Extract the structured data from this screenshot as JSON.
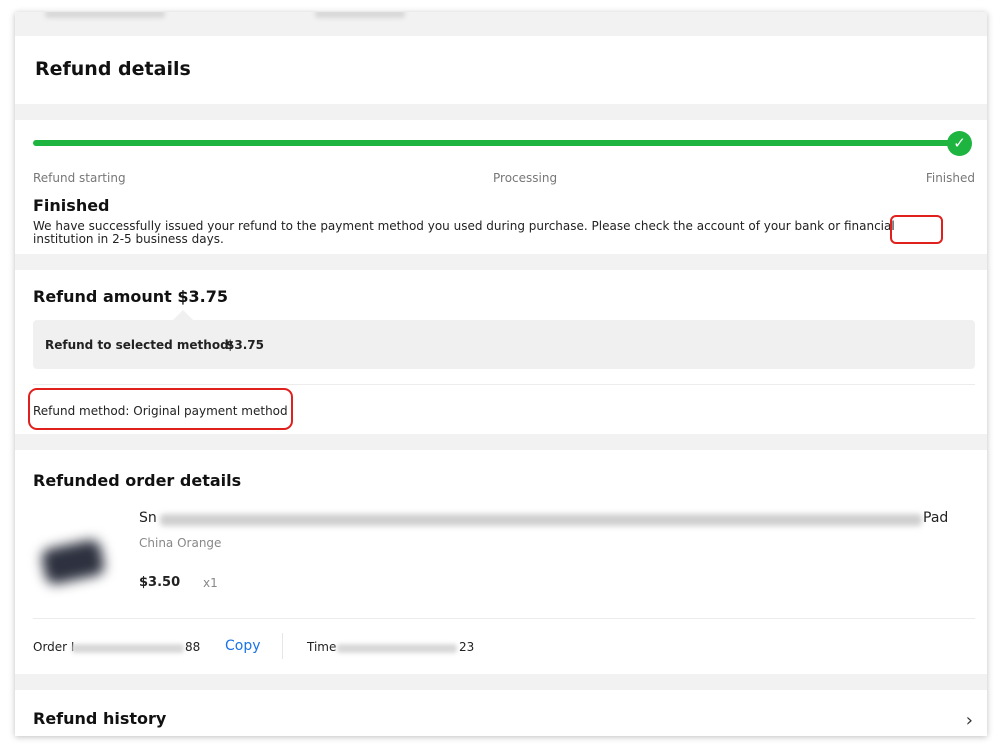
{
  "page": {
    "title": "Refund details"
  },
  "progress": {
    "steps": [
      "Refund starting",
      "Processing",
      "Finished"
    ],
    "current_step": 3,
    "status_title": "Finished",
    "status_text": "We have successfully issued your refund to the payment method you used during purchase. Please check the account of your bank or financial institution in 2-5 business days."
  },
  "refund": {
    "title": "Refund amount $3.75",
    "selected_label": "Refund to selected method:",
    "selected_value": "$3.75",
    "method": "Refund method: Original payment method"
  },
  "order": {
    "title": "Refunded order details",
    "product_prefix": "Sn",
    "product_suffix": "Pad",
    "variant": "China Orange",
    "price": "$3.50",
    "quantity": "x1",
    "order_label": "Order I",
    "order_suffix": "88",
    "copy_label": "Copy",
    "time_label": "Time",
    "time_suffix": "23"
  },
  "history": {
    "title": "Refund history"
  },
  "icons": {
    "check": "check-icon",
    "chevron": "chevron-right-icon"
  },
  "colors": {
    "progress": "#1db540",
    "link": "#1a73e8",
    "highlight": "#e0201c"
  }
}
